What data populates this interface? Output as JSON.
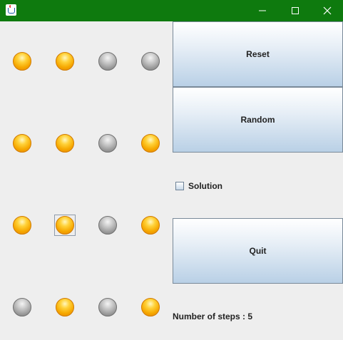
{
  "window": {
    "title": "",
    "icon": "java-cup-icon",
    "controls": [
      "minimize-icon",
      "maximize-icon",
      "close-icon"
    ],
    "titlebar_color": "#0e7a0e"
  },
  "board": {
    "rows": [
      [
        "on",
        "on",
        "off",
        "off"
      ],
      [
        "on",
        "on",
        "off",
        "on"
      ],
      [
        "on",
        "on",
        "off",
        "on"
      ],
      [
        "off",
        "on",
        "off",
        "on"
      ]
    ],
    "focused": [
      2,
      1
    ],
    "on_color": "#f6a800",
    "off_color": "#9a9a9a"
  },
  "controls": {
    "reset_label": "Reset",
    "random_label": "Random",
    "solution_label": "Solution",
    "solution_checked": false,
    "quit_label": "Quit",
    "steps_text": "Number of steps : 5"
  }
}
